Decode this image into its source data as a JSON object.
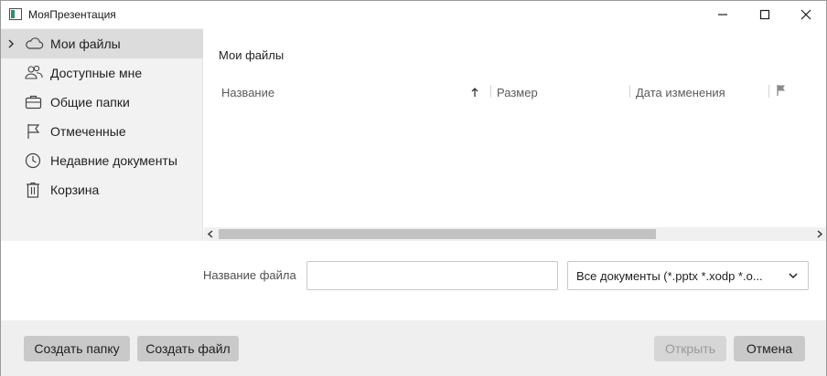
{
  "window": {
    "title": "МояПрезентация",
    "controls": {
      "minimize": "minimize-icon",
      "maximize": "maximize-icon",
      "close": "close-icon"
    }
  },
  "sidebar": {
    "items": [
      {
        "label": "Мои файлы",
        "icon": "cloud-icon",
        "selected": true,
        "expandable": true
      },
      {
        "label": "Доступные мне",
        "icon": "people-icon",
        "selected": false
      },
      {
        "label": "Общие папки",
        "icon": "briefcase-icon",
        "selected": false
      },
      {
        "label": "Отмеченные",
        "icon": "flag-icon",
        "selected": false
      },
      {
        "label": "Недавние документы",
        "icon": "clock-icon",
        "selected": false
      },
      {
        "label": "Корзина",
        "icon": "trash-icon",
        "selected": false
      }
    ]
  },
  "main": {
    "folder_title": "Мои файлы",
    "columns": [
      {
        "label": "Название",
        "sorted": "ascending"
      },
      {
        "label": "Размер"
      },
      {
        "label": "Дата изменения"
      },
      {
        "label": "",
        "icon": "flag-icon"
      }
    ],
    "rows": []
  },
  "filename": {
    "label": "Название файла",
    "value": "",
    "placeholder": ""
  },
  "filter": {
    "selected": "Все документы (*.pptx *.xodp *.o..."
  },
  "buttons": {
    "new_folder": "Создать папку",
    "new_file": "Создать файл",
    "open": "Открыть",
    "cancel": "Отмена",
    "open_enabled": false
  },
  "colors": {
    "sidebar_bg": "#f2f2f2",
    "selected_bg": "#dcdcdc",
    "footer_bg": "#efefef",
    "button_bg": "#c9c9c9",
    "disabled_text": "#9a9a9a"
  }
}
